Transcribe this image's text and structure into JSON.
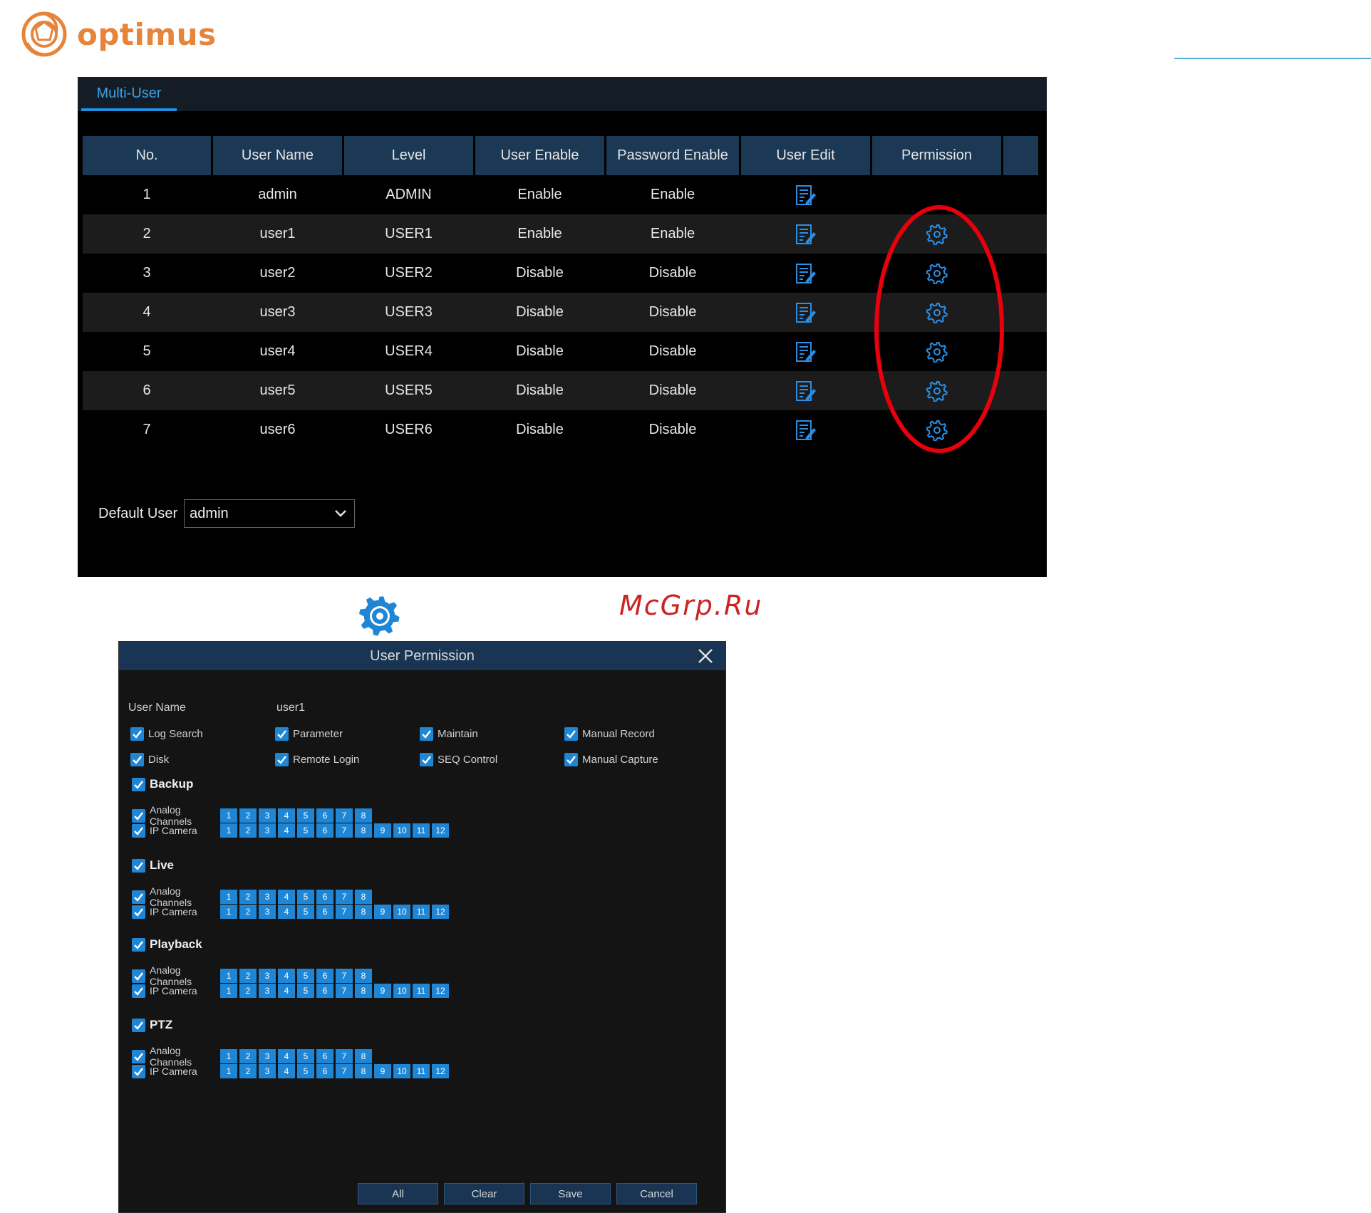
{
  "brand": {
    "name": "optimus",
    "color": "#e6843a"
  },
  "colors": {
    "accent": "#1f86d6",
    "header_bg": "#1b3855",
    "annotation_red": "#e8000c"
  },
  "multi_user": {
    "tab": "Multi-User",
    "columns": [
      "No.",
      "User Name",
      "Level",
      "User Enable",
      "Password Enable",
      "User Edit",
      "Permission"
    ],
    "rows": [
      {
        "no": "1",
        "user": "admin",
        "level": "ADMIN",
        "user_enable": "Enable",
        "pwd_enable": "Enable",
        "has_permission": false
      },
      {
        "no": "2",
        "user": "user1",
        "level": "USER1",
        "user_enable": "Enable",
        "pwd_enable": "Enable",
        "has_permission": true
      },
      {
        "no": "3",
        "user": "user2",
        "level": "USER2",
        "user_enable": "Disable",
        "pwd_enable": "Disable",
        "has_permission": true
      },
      {
        "no": "4",
        "user": "user3",
        "level": "USER3",
        "user_enable": "Disable",
        "pwd_enable": "Disable",
        "has_permission": true
      },
      {
        "no": "5",
        "user": "user4",
        "level": "USER4",
        "user_enable": "Disable",
        "pwd_enable": "Disable",
        "has_permission": true
      },
      {
        "no": "6",
        "user": "user5",
        "level": "USER5",
        "user_enable": "Disable",
        "pwd_enable": "Disable",
        "has_permission": true
      },
      {
        "no": "7",
        "user": "user6",
        "level": "USER6",
        "user_enable": "Disable",
        "pwd_enable": "Disable",
        "has_permission": true
      }
    ],
    "default_user_label": "Default User",
    "default_user_value": "admin",
    "icons": {
      "edit": "edit-icon",
      "permission": "gear-icon",
      "dropdown": "chevron-down-icon"
    }
  },
  "watermark": "McGrp.Ru",
  "permission_dialog": {
    "title": "User Permission",
    "user_name_label": "User Name",
    "user_name_value": "user1",
    "permissions": [
      {
        "label": "Log Search",
        "checked": true
      },
      {
        "label": "Parameter",
        "checked": true
      },
      {
        "label": "Maintain",
        "checked": true
      },
      {
        "label": "Manual Record",
        "checked": true
      },
      {
        "label": "Disk",
        "checked": true
      },
      {
        "label": "Remote Login",
        "checked": true
      },
      {
        "label": "SEQ Control",
        "checked": true
      },
      {
        "label": "Manual Capture",
        "checked": true
      }
    ],
    "sections": [
      {
        "title": "Backup",
        "checked": true
      },
      {
        "title": "Live",
        "checked": true
      },
      {
        "title": "Playback",
        "checked": true
      },
      {
        "title": "PTZ",
        "checked": true
      }
    ],
    "analog_label": "Analog Channels",
    "ip_label": "IP Camera",
    "analog_channels": [
      "1",
      "2",
      "3",
      "4",
      "5",
      "6",
      "7",
      "8"
    ],
    "ip_channels": [
      "1",
      "2",
      "3",
      "4",
      "5",
      "6",
      "7",
      "8",
      "9",
      "10",
      "11",
      "12"
    ],
    "buttons": [
      "All",
      "Clear",
      "Save",
      "Cancel"
    ]
  }
}
